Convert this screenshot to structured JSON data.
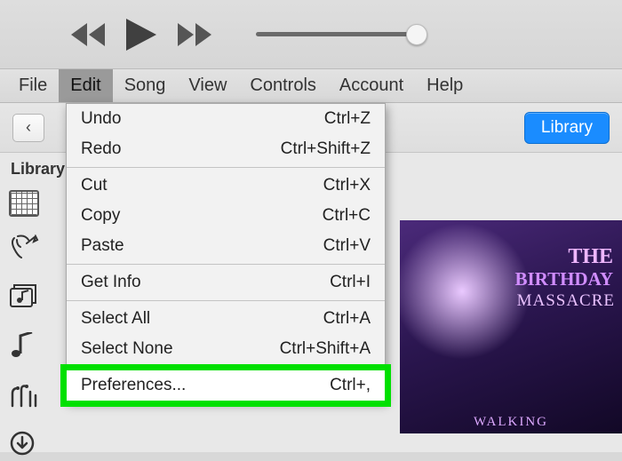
{
  "menubar": {
    "items": [
      "File",
      "Edit",
      "Song",
      "View",
      "Controls",
      "Account",
      "Help"
    ],
    "active_index": 1
  },
  "toolbar": {
    "back_glyph": "‹",
    "library_button": "Library"
  },
  "sidebar": {
    "section_label": "Library"
  },
  "dropdown": {
    "groups": [
      [
        {
          "label": "Undo",
          "shortcut": "Ctrl+Z"
        },
        {
          "label": "Redo",
          "shortcut": "Ctrl+Shift+Z"
        }
      ],
      [
        {
          "label": "Cut",
          "shortcut": "Ctrl+X"
        },
        {
          "label": "Copy",
          "shortcut": "Ctrl+C"
        },
        {
          "label": "Paste",
          "shortcut": "Ctrl+V"
        }
      ],
      [
        {
          "label": "Get Info",
          "shortcut": "Ctrl+I"
        }
      ],
      [
        {
          "label": "Select All",
          "shortcut": "Ctrl+A"
        },
        {
          "label": "Select None",
          "shortcut": "Ctrl+Shift+A"
        }
      ],
      [
        {
          "label": "Preferences...",
          "shortcut": "Ctrl+,",
          "highlight": true
        }
      ]
    ]
  },
  "album": {
    "line1": "THE",
    "line2": "BIRTHDAY",
    "line3": "MASSACRE",
    "line4": "WALKING"
  }
}
